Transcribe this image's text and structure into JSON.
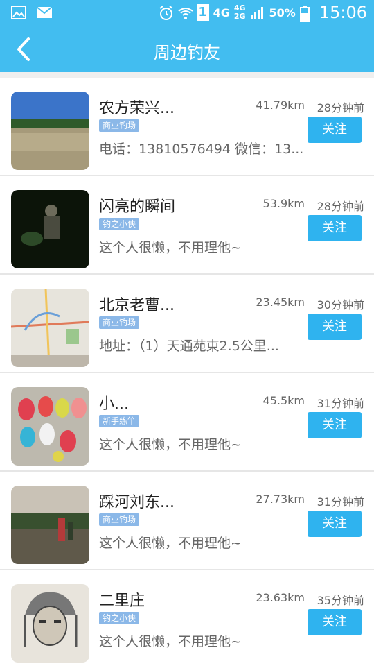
{
  "status_bar": {
    "left_icons": [
      "gallery-icon",
      "mail-icon"
    ],
    "signal_labels": [
      "4G",
      "4G",
      "2G"
    ],
    "sim_slot": "1",
    "battery": "50%",
    "time": "15:06"
  },
  "header": {
    "title": "周边钓友"
  },
  "users": [
    {
      "name": "农方荣兴...",
      "distance": "41.79km",
      "time": "28分钟前",
      "badge": "商业钓场",
      "desc": "电话：13810576494 微信：13...",
      "follow": "关注"
    },
    {
      "name": "闪亮的瞬间",
      "distance": "53.9km",
      "time": "28分钟前",
      "badge": "钓之小侠",
      "desc": "这个人很懒，不用理他~",
      "follow": "关注"
    },
    {
      "name": "北京老曹...",
      "distance": "23.45km",
      "time": "30分钟前",
      "badge": "商业钓场",
      "desc": "地址：（1）天通苑東2.5公里...",
      "follow": "关注"
    },
    {
      "name": "小...",
      "distance": "45.5km",
      "time": "31分钟前",
      "badge": "新手练竿",
      "desc": "这个人很懒，不用理他~",
      "follow": "关注"
    },
    {
      "name": "踩河刘东...",
      "distance": "27.73km",
      "time": "31分钟前",
      "badge": "商业钓场",
      "desc": "这个人很懒，不用理他~",
      "follow": "关注"
    },
    {
      "name": "二里庄",
      "distance": "23.63km",
      "time": "35分钟前",
      "badge": "钓之小侠",
      "desc": "这个人很懒，不用理他~",
      "follow": "关注"
    }
  ],
  "colors": {
    "accent": "#42bdf0",
    "button": "#2fb3ef",
    "badge": "#8bb8e8"
  }
}
